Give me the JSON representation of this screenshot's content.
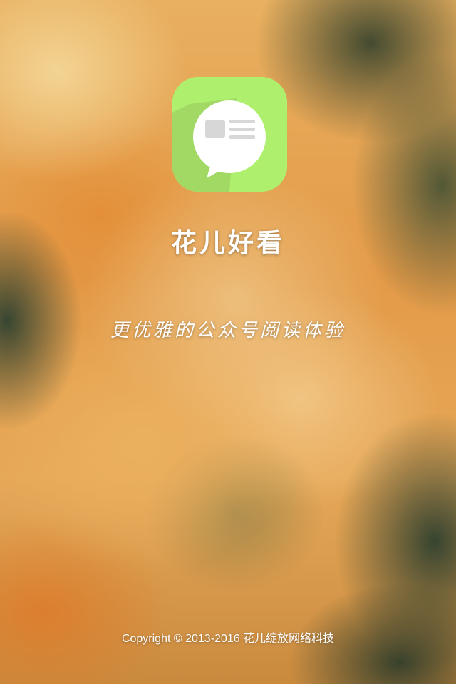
{
  "app": {
    "name": "花儿好看",
    "slogan": "更优雅的公众号阅读体验",
    "icon": "speech-bubble-article-icon"
  },
  "footer": {
    "copyright": "Copyright © 2013-2016 花儿绽放网络科技"
  },
  "colors": {
    "icon_background": "#aef06e",
    "icon_shadow": "#9ed05f",
    "text": "#ffffff"
  }
}
